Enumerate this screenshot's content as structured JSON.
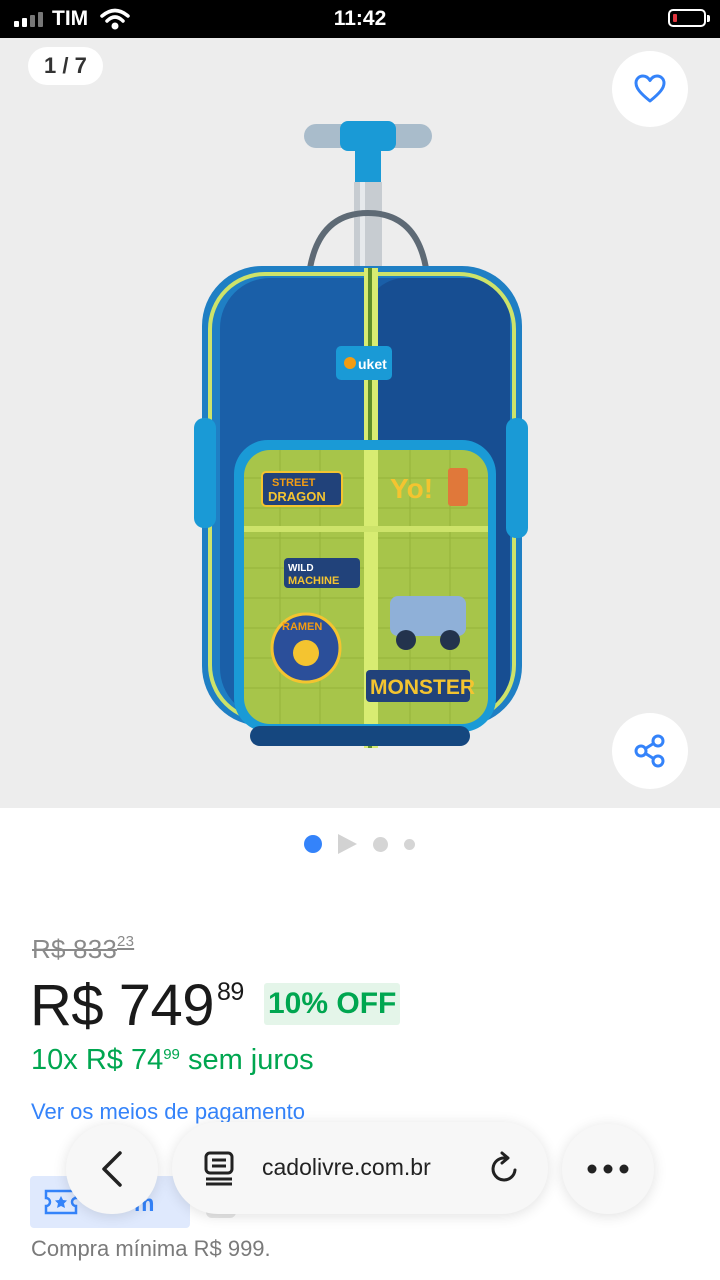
{
  "status": {
    "carrier": "TIM",
    "time": "11:42"
  },
  "gallery": {
    "counter": "1 / 7",
    "total_images": 7,
    "current_image": 1
  },
  "product": {
    "old_price": "R$ 833",
    "old_price_cents": "23",
    "price": "R$ 749",
    "price_cents": "89",
    "discount": "10% OFF",
    "installments": "10x R$ 74",
    "installments_cents": "99",
    "installments_suffix": "sem juros",
    "payment_link": "Ver os meios de pagamento"
  },
  "coupon": {
    "label": "om"
  },
  "min_purchase": "Compra mínima R$ 999.",
  "browser": {
    "url": "cadolivre.com.br"
  },
  "colors": {
    "accent": "#3483fa",
    "green": "#00a650",
    "discount_bg": "#e4f5e9"
  },
  "icons": [
    "heart-icon",
    "share-icon",
    "back-arrow-icon",
    "tabs-icon",
    "reload-icon",
    "more-icon",
    "coupon-icon"
  ]
}
